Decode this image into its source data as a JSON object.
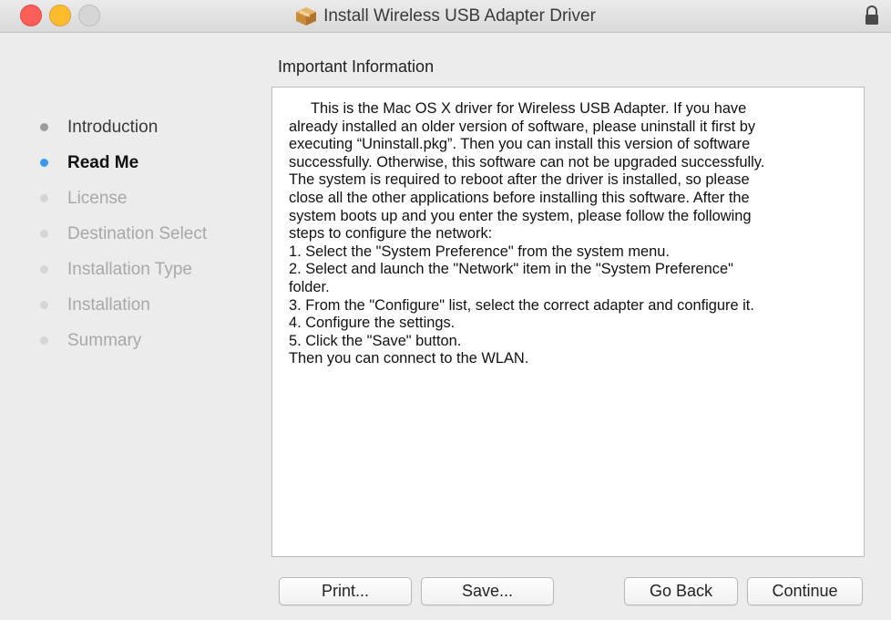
{
  "window": {
    "title": "Install Wireless USB Adapter Driver",
    "icon": "package-icon",
    "controls": [
      "close",
      "minimize",
      "maximize"
    ],
    "locked": true
  },
  "sidebar": {
    "steps": [
      {
        "label": "Introduction",
        "state": "done"
      },
      {
        "label": "Read Me",
        "state": "current"
      },
      {
        "label": "License",
        "state": "pending"
      },
      {
        "label": "Destination Select",
        "state": "pending"
      },
      {
        "label": "Installation Type",
        "state": "pending"
      },
      {
        "label": "Installation",
        "state": "pending"
      },
      {
        "label": "Summary",
        "state": "pending"
      }
    ]
  },
  "main": {
    "section_title": "Important Information",
    "content_lines": [
      "This is the Mac OS X driver for Wireless USB Adapter. If you have",
      "already installed an older version of software, please uninstall it first by",
      "executing “Uninstall.pkg”. Then you can install this version of software",
      "successfully. Otherwise, this software can not be upgraded successfully.",
      "The system is required to reboot after the driver is installed, so please",
      "close all the other applications before installing this software. After the",
      "system boots up and you enter the system, please follow the following",
      "steps to configure the network:",
      "1. Select the \"System Preference\" from the system menu.",
      "2. Select and launch the \"Network\" item in the \"System Preference\"",
      "folder.",
      "3. From the \"Configure\" list, select the correct adapter and configure it.",
      "4. Configure the settings.",
      "5. Click the \"Save\" button.",
      "Then you can connect to the WLAN."
    ]
  },
  "buttons": {
    "print": "Print...",
    "save": "Save...",
    "go_back": "Go Back",
    "continue": "Continue"
  },
  "colors": {
    "close": "#fc5f57",
    "minimize": "#fdbc2e",
    "maximize": "#d6d6d6",
    "current_step_dot": "#3d97f0",
    "done_step_dot": "#9c9c9c",
    "pending_step_dot": "#d5d5d5"
  }
}
